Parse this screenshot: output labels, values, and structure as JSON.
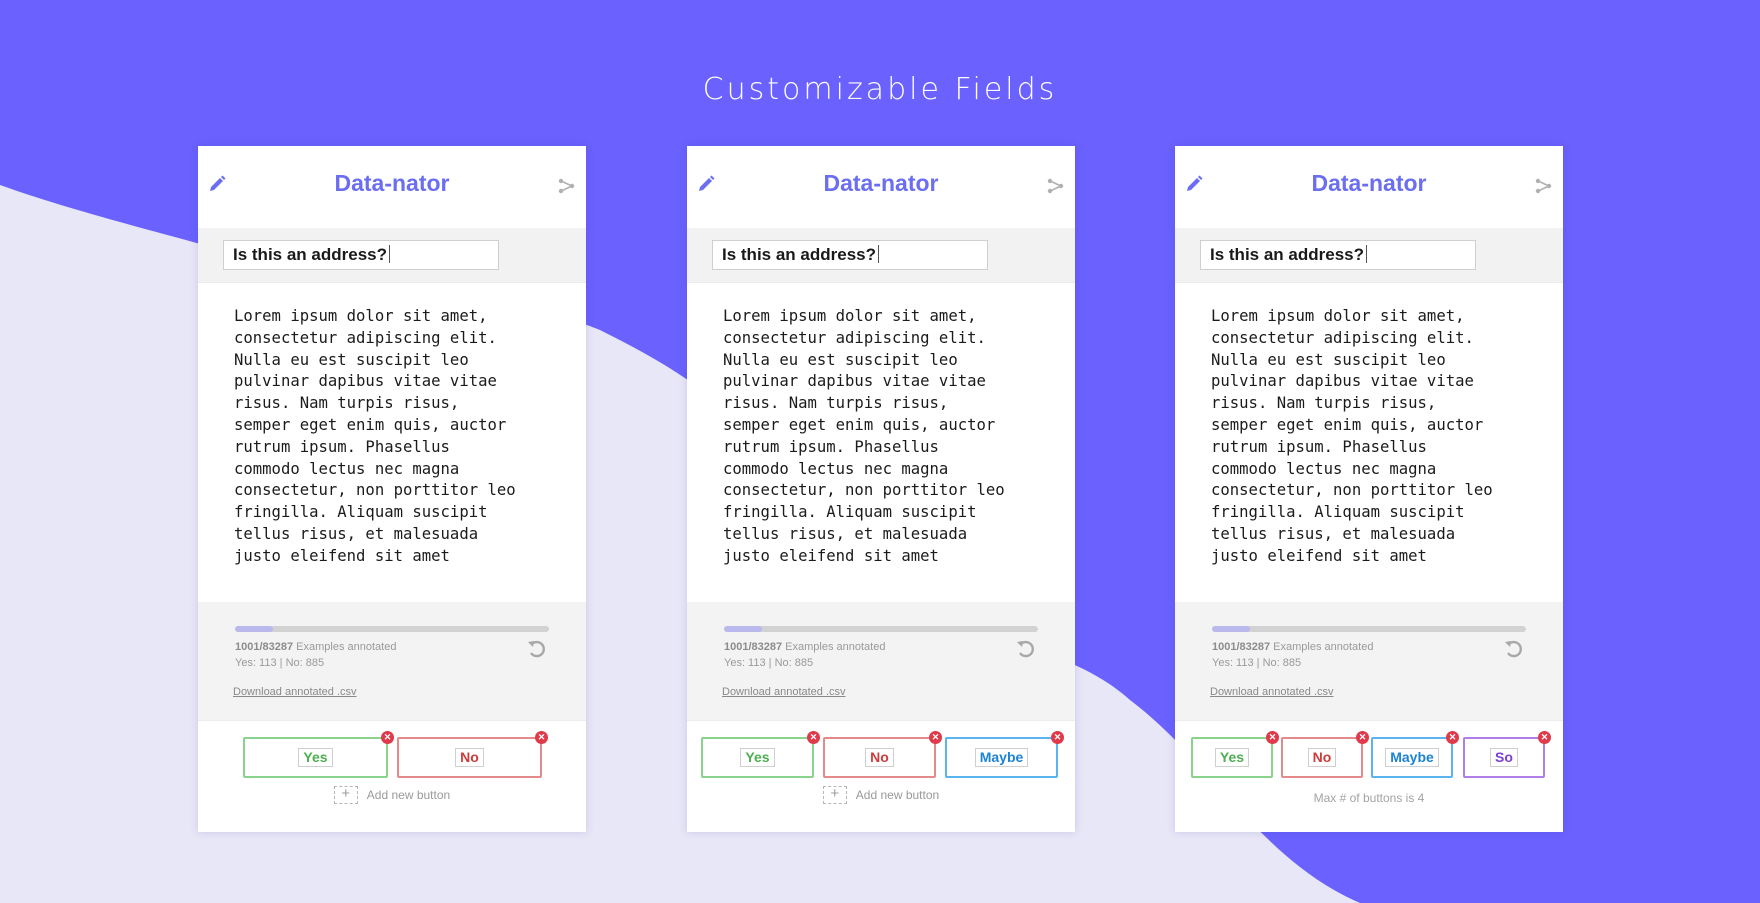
{
  "page": {
    "heading": "Customizable Fields"
  },
  "card": {
    "title": "Data-nator",
    "question": "Is this an address?",
    "text": "Lorem ipsum dolor sit amet,\nconsectetur adipiscing elit.\nNulla eu est suscipit leo\npulvinar dapibus vitae vitae\nrisus. Nam turpis risus,\nsemper eget enim quis, auctor\nrutrum ipsum. Phasellus\ncommodo lectus nec magna\nconsectetur, non porttitor leo\nfringilla. Aliquam suscipit\ntellus risus, et malesuada\njusto eleifend sit amet",
    "progress_count": "1001/83287",
    "progress_label": " Examples annotated",
    "progress_fraction": 0.12,
    "tally_yes": "Yes: 113",
    "tally_separator": "|",
    "tally_no": "No: 885",
    "download_label": "Download annotated .csv",
    "add_button_label": "Add new button",
    "max_note": "Max # of buttons is 4"
  },
  "buttons": {
    "yes": "Yes",
    "no": "No",
    "maybe": "Maybe",
    "so": "So"
  },
  "icons": {
    "edit": "pencil-icon",
    "share": "share-icon",
    "undo": "undo-icon",
    "remove": "remove-icon",
    "add": "plus-icon"
  },
  "colors": {
    "brand": "#6b6ef0",
    "background_purple": "#6a61ff",
    "background_light": "#e8e7f7",
    "yes": "#4fae52",
    "no": "#cf3b3b",
    "maybe": "#1c83d3",
    "so": "#7f3fd4"
  }
}
